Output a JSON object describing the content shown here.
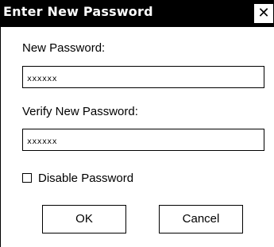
{
  "window": {
    "title": "Enter New Password",
    "close_glyph": "✕"
  },
  "new_password": {
    "label": "New Password:",
    "value": "xxxxxx"
  },
  "verify_password": {
    "label": "Verify New Password:",
    "value": "xxxxxx"
  },
  "disable_password": {
    "label": "Disable Password",
    "checked": false
  },
  "buttons": {
    "ok_label": "OK",
    "cancel_label": "Cancel"
  },
  "colors": {
    "titlebar_bg": "#000000",
    "title_text": "#ffffff",
    "dialog_bg": "#ffffff"
  }
}
